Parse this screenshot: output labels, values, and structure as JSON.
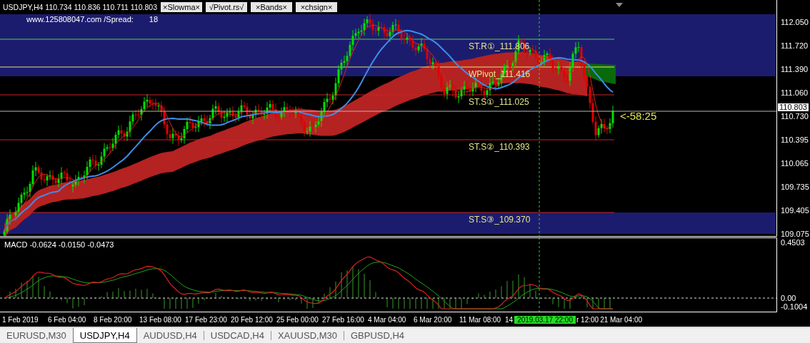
{
  "chart": {
    "symbol_info": "USDJPY,H4 110.734 110.836 110.711 110.803",
    "indicator_buttons": [
      {
        "label": "×Slowma×"
      },
      {
        "label": "√Pivot.rs√"
      },
      {
        "label": "×Bands×"
      },
      {
        "label": "×chsign×"
      }
    ],
    "info_line": "www.125808047.com /Spread:",
    "spread": "18",
    "pivot_levels": [
      {
        "label": "ST.R①_111.806",
        "kind": "resistance"
      },
      {
        "label": "WPivot_111.416",
        "kind": "pivot"
      },
      {
        "label": "ST.S①_111.025",
        "kind": "support"
      },
      {
        "label": "ST.S②_110.393",
        "kind": "support"
      },
      {
        "label": "ST.S③_109.370",
        "kind": "support"
      }
    ],
    "countdown": "<-58:25",
    "price_axis": [
      "112.050",
      "111.720",
      "111.390",
      "111.060",
      "110.730",
      "110.395",
      "110.065",
      "109.735",
      "109.405",
      "109.075"
    ],
    "current_price": "110.803"
  },
  "macd": {
    "label": "MACD -0.0624 -0.0150 -0.0473",
    "axis": [
      "0.4503",
      "0.00",
      "-0.1004"
    ]
  },
  "time_axis": [
    {
      "label": "1 Feb 2019",
      "kind": "tick"
    },
    {
      "label": "6 Feb 04:00",
      "kind": "tick"
    },
    {
      "label": "8 Feb 20:00",
      "kind": "tick"
    },
    {
      "label": "13 Feb 08:00",
      "kind": "tick"
    },
    {
      "label": "17 Feb 23:00",
      "kind": "tick"
    },
    {
      "label": "20 Feb 12:00",
      "kind": "tick"
    },
    {
      "label": "25 Feb 00:00",
      "kind": "tick"
    },
    {
      "label": "27 Feb 16:00",
      "kind": "tick"
    },
    {
      "label": "4 Mar 04:00",
      "kind": "tick"
    },
    {
      "label": "6 Mar 20:00",
      "kind": "tick"
    },
    {
      "label": "11 Mar 08:00",
      "kind": "tick"
    },
    {
      "label": "14",
      "kind": "cut"
    },
    {
      "label": "2019.03.17 22:00",
      "kind": "crosshair"
    },
    {
      "label": "r 12:00",
      "kind": "cut"
    },
    {
      "label": "21 Mar 04:00",
      "kind": "tick"
    }
  ],
  "tabs": [
    {
      "label": "EURUSD,M30",
      "selected": false
    },
    {
      "label": "USDJPY,H4",
      "selected": true
    },
    {
      "label": "AUDUSD,H4",
      "selected": false
    },
    {
      "label": "USDCAD,H4",
      "selected": false
    },
    {
      "label": "XAUUSD,M30",
      "selected": false
    },
    {
      "label": "GBPUSD,H4",
      "selected": false
    }
  ]
}
